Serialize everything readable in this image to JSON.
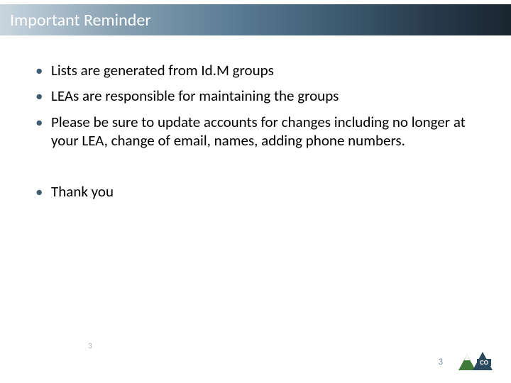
{
  "slide": {
    "title": "Important Reminder",
    "bullets_a": [
      "Lists are generated from Id.M groups",
      "LEAs are responsible for maintaining the groups",
      "Please be sure to update accounts for changes including no longer at your LEA, change of email, names, adding phone numbers."
    ],
    "bullets_b": [
      "Thank you"
    ],
    "page_number_left": "3",
    "page_number_right": "3",
    "logo": {
      "name": "co-mountain-logo"
    },
    "colors": {
      "title_gradient_start": "#c9d6df",
      "title_gradient_end": "#1a252f",
      "bullet_accent": "#3e5d73"
    }
  }
}
